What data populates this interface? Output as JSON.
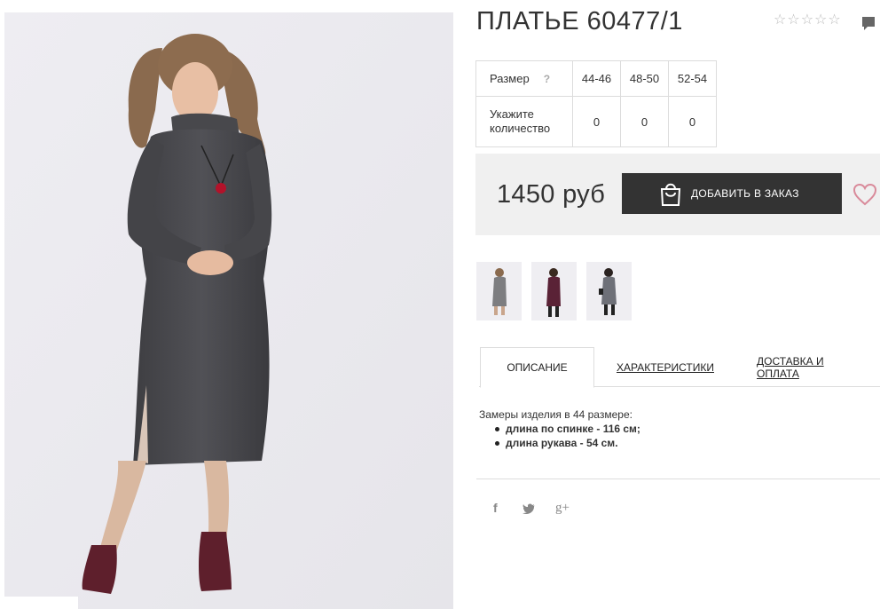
{
  "product": {
    "title": "ПЛАТЬЕ 60477/1",
    "rating_stars": 5,
    "rating_value": 0
  },
  "size_table": {
    "size_label": "Размер",
    "help_label": "?",
    "sizes": [
      "44-46",
      "48-50",
      "52-54"
    ],
    "qty_label_line1": "Укажите",
    "qty_label_line2": "количество",
    "quantities": [
      "0",
      "0",
      "0"
    ]
  },
  "purchase": {
    "price": "1450 руб",
    "add_button_label": "ДОБАВИТЬ В ЗАКАЗ",
    "icons": {
      "cart": "shopping-bag-icon",
      "wishlist": "heart-icon"
    }
  },
  "thumbnails": [
    {
      "name": "thumb-grey-dress",
      "dress_color": "#7d7d80"
    },
    {
      "name": "thumb-burgundy-dress",
      "dress_color": "#5a2236"
    },
    {
      "name": "thumb-grey-dress-2",
      "dress_color": "#6e7078"
    }
  ],
  "tabs": [
    {
      "label": "ОПИСАНИЕ",
      "active": true
    },
    {
      "label": "ХАРАКТЕРИСТИКИ",
      "active": false
    },
    {
      "label": "ДОСТАВКА И ОПЛАТА",
      "active": false
    }
  ],
  "description": {
    "intro": "Замеры изделия в 44 размере:",
    "items": [
      {
        "text": "длина по спинке - ",
        "value": "116 см;"
      },
      {
        "text": "длина рукава - 54 см.",
        "value": ""
      }
    ]
  },
  "social": [
    {
      "label": "f",
      "icon": "facebook-icon"
    },
    {
      "label": "t",
      "icon": "twitter-icon"
    },
    {
      "label": "g+",
      "icon": "google-plus-icon"
    }
  ],
  "colors": {
    "accent_heart": "#d98a9a",
    "button_bg": "#333333",
    "price_box_bg": "#f0f0f0",
    "dress_main": "#4a4a4e",
    "boots": "#5e1f2c"
  }
}
